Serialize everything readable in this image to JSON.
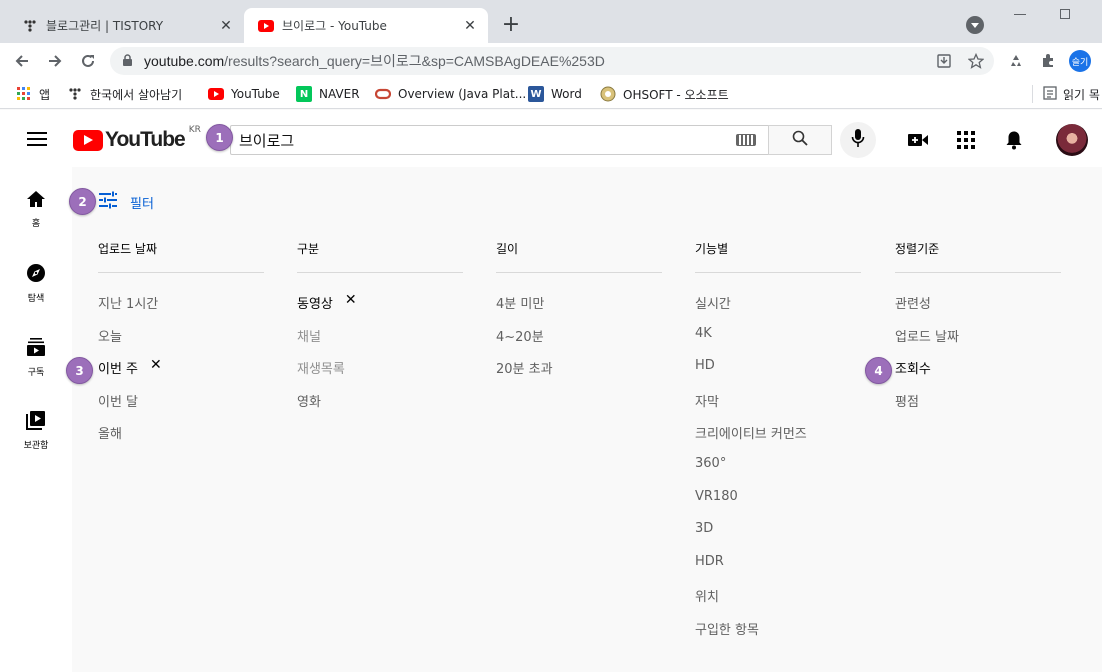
{
  "browser": {
    "tabs": [
      {
        "title": "블로그관리 | TISTORY",
        "active": false
      },
      {
        "title": "브이로그 - YouTube",
        "active": true
      }
    ],
    "url_main": "youtube.com",
    "url_rest": "/results?search_query=브이로그&sp=CAMSBAgDEAE%253D",
    "profile_label": "슬기"
  },
  "bookmarks": {
    "items": [
      {
        "label": "앱"
      },
      {
        "label": "한국에서 살아남기"
      },
      {
        "label": "YouTube"
      },
      {
        "label": "NAVER"
      },
      {
        "label": "Overview (Java Plat..."
      },
      {
        "label": "Word"
      },
      {
        "label": "OHSOFT - 오소프트"
      }
    ],
    "reading_list": "읽기 목"
  },
  "youtube": {
    "logo_text": "YouTube",
    "region": "KR",
    "search_value": "브이로그",
    "guide": [
      {
        "label": "홈",
        "icon": "home-icon"
      },
      {
        "label": "탐색",
        "icon": "explore-icon"
      },
      {
        "label": "구독",
        "icon": "subscriptions-icon"
      },
      {
        "label": "보관함",
        "icon": "library-icon"
      }
    ],
    "filter_label": "필터",
    "filters": [
      {
        "header": "업로드 날짜",
        "options": [
          {
            "label": "지난 1시간",
            "state": "normal"
          },
          {
            "label": "오늘",
            "state": "normal"
          },
          {
            "label": "이번 주",
            "state": "selected"
          },
          {
            "label": "이번 달",
            "state": "normal"
          },
          {
            "label": "올해",
            "state": "normal"
          }
        ]
      },
      {
        "header": "구분",
        "options": [
          {
            "label": "동영상",
            "state": "selected"
          },
          {
            "label": "채널",
            "state": "disabled"
          },
          {
            "label": "재생목록",
            "state": "disabled"
          },
          {
            "label": "영화",
            "state": "normal"
          }
        ]
      },
      {
        "header": "길이",
        "options": [
          {
            "label": "4분 미만",
            "state": "normal"
          },
          {
            "label": "4~20분",
            "state": "normal"
          },
          {
            "label": "20분 초과",
            "state": "normal"
          }
        ]
      },
      {
        "header": "기능별",
        "options": [
          {
            "label": "실시간",
            "state": "normal"
          },
          {
            "label": "4K",
            "state": "normal"
          },
          {
            "label": "HD",
            "state": "normal"
          },
          {
            "label": "자막",
            "state": "normal"
          },
          {
            "label": "크리에이티브 커먼즈",
            "state": "normal"
          },
          {
            "label": "360°",
            "state": "normal"
          },
          {
            "label": "VR180",
            "state": "normal"
          },
          {
            "label": "3D",
            "state": "normal"
          },
          {
            "label": "HDR",
            "state": "normal"
          },
          {
            "label": "위치",
            "state": "normal"
          },
          {
            "label": "구입한 항목",
            "state": "normal"
          }
        ]
      },
      {
        "header": "정렬기준",
        "options": [
          {
            "label": "관련성",
            "state": "normal"
          },
          {
            "label": "업로드 날짜",
            "state": "normal"
          },
          {
            "label": "조회수",
            "state": "selected"
          },
          {
            "label": "평점",
            "state": "normal"
          }
        ]
      }
    ]
  },
  "markers": [
    "1",
    "2",
    "3",
    "4"
  ],
  "colors": {
    "marker": "#9c6fba",
    "link": "#065fd4",
    "brand": "#ff0000"
  }
}
